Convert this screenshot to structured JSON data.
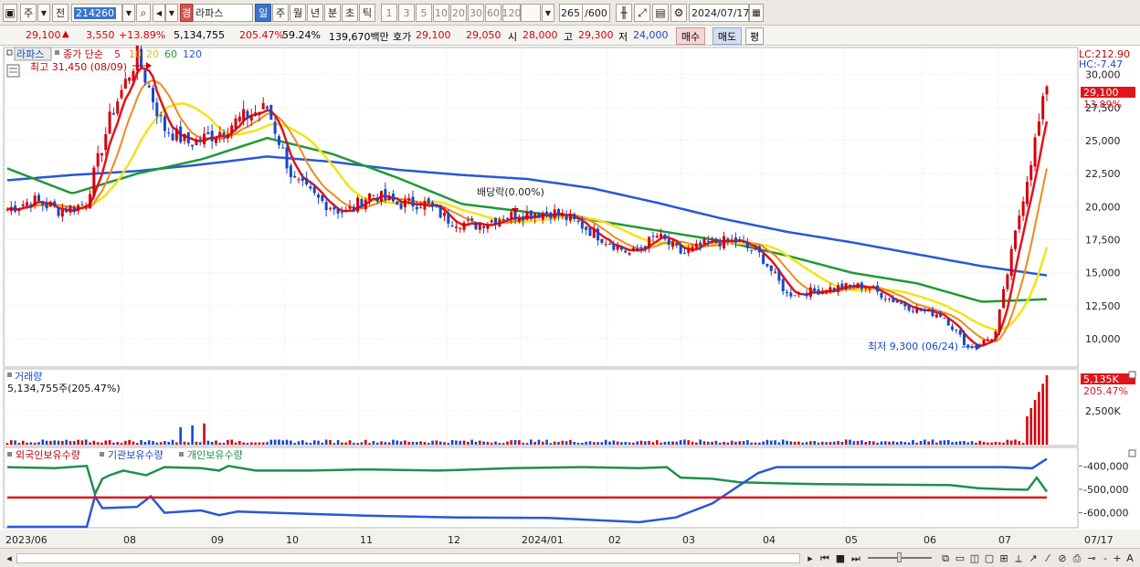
{
  "toolbar": {
    "market": "주",
    "prev": "전",
    "code": "214260",
    "name_prefix": "경",
    "name": "라파스",
    "periods": [
      "일",
      "주",
      "월",
      "년",
      "분",
      "초",
      "틱"
    ],
    "active_period": "일",
    "intervals": [
      "1",
      "3",
      "5",
      "10",
      "20",
      "30",
      "60",
      "120"
    ],
    "count": "265",
    "count_total": "/600",
    "date": "2024/07/17"
  },
  "quote": {
    "price": "29,100",
    "change": "3,550",
    "change_pct": "+13.89%",
    "volume": "5,134,755",
    "volume_ratio": "205.47%",
    "turnover_ratio": "59.24%",
    "amount": "139,670백만",
    "bid_label": "호가",
    "ask": "29,100",
    "bid": "29,050",
    "open_label": "시",
    "open": "28,000",
    "high_label": "고",
    "high": "29,300",
    "low_label": "저",
    "low": "24,000",
    "buy_label": "매수",
    "sell_label": "매도",
    "eval_label": "평"
  },
  "legend": {
    "name": "라파스",
    "ma_label": "종가 단순",
    "ma_periods": [
      "5",
      "10",
      "20",
      "60",
      "120"
    ],
    "max_label": "최고 31,450 (08/09)",
    "min_label": "최저 9,300 (06/24)",
    "dividend_label": "배당락(0.00%)",
    "lc": "LC:212.90",
    "hc": "HC:-7.47",
    "last_price": "29,100",
    "last_pct": "13.89%"
  },
  "volume_panel": {
    "title": "거래량",
    "value_label": "5,134,755주(205.47%)",
    "last_value": "5,135K",
    "last_pct": "205.47%"
  },
  "flow_panel": {
    "foreign": "외국인보유수량",
    "institution": "기관보유수량",
    "individual": "개인보유수량"
  },
  "colors": {
    "up": "#d4000d",
    "down": "#1747c9",
    "ma5": "#e0141a",
    "ma10": "#f08a1c",
    "ma20": "#f5e218",
    "ma60": "#1f9a34",
    "ma120": "#2857d9",
    "foreign": "#1f8f4d",
    "institution": "#2857d9",
    "individual": "#e0141a"
  },
  "chart_data": {
    "type": "line",
    "title": "라파스",
    "x_ticks": [
      "2023/06",
      "08",
      "09",
      "10",
      "11",
      "12",
      "2024/01",
      "02",
      "03",
      "04",
      "05",
      "06",
      "07",
      "07/17"
    ],
    "price_axis": {
      "ticks": [
        10000,
        12500,
        15000,
        17500,
        20000,
        22500,
        25000,
        27500,
        30000
      ],
      "tick_labels": [
        "10,000",
        "12,500",
        "15,000",
        "17,500",
        "20,000",
        "22,500",
        "25,000",
        "27,500",
        "30,000"
      ],
      "ylim": [
        8000,
        31500
      ]
    },
    "close_path": [
      [
        "2023/06",
        19800
      ],
      [
        "2023/07 early",
        20500
      ],
      [
        "2023/07 mid",
        19700
      ],
      [
        "2023/07 late",
        20200
      ],
      [
        "2023/08 early",
        27000
      ],
      [
        "2023/08/09",
        31450
      ],
      [
        "2023/08 mid",
        26000
      ],
      [
        "2023/08 late",
        24800
      ],
      [
        "2023/09 early",
        25500
      ],
      [
        "2023/09 mid",
        26700
      ],
      [
        "2023/09 late",
        27500
      ],
      [
        "2023/10 early",
        22000
      ],
      [
        "2023/10 mid",
        20500
      ],
      [
        "2023/10 late",
        19500
      ],
      [
        "2023/11 early",
        21000
      ],
      [
        "2023/11 mid",
        20200
      ],
      [
        "2023/11 late",
        20300
      ],
      [
        "2023/12 early",
        19000
      ],
      [
        "2023/12 mid",
        18600
      ],
      [
        "2023/12 late",
        19200
      ],
      [
        "2024/01 early",
        19500
      ],
      [
        "2024/01 mid",
        19600
      ],
      [
        "2024/01 late",
        18700
      ],
      [
        "2024/02 early",
        17500
      ],
      [
        "2024/02 mid",
        16400
      ],
      [
        "2024/02 late",
        17800
      ],
      [
        "2024/03 early",
        16400
      ],
      [
        "2024/03 mid",
        17300
      ],
      [
        "2024/03 late",
        17400
      ],
      [
        "2024/04 early",
        16300
      ],
      [
        "2024/04 mid",
        13400
      ],
      [
        "2024/04 late",
        13600
      ],
      [
        "2024/05 early",
        13900
      ],
      [
        "2024/05 mid",
        14000
      ],
      [
        "2024/05 late",
        13000
      ],
      [
        "2024/06 early",
        12200
      ],
      [
        "2024/06 mid",
        11800
      ],
      [
        "2024/06/24",
        9300
      ],
      [
        "2024/07 early",
        10200
      ],
      [
        "2024/07 mid",
        20000
      ],
      [
        "2024/07/17",
        29100
      ]
    ],
    "ma120_path": [
      22000,
      22400,
      22700,
      23200,
      23800,
      23400,
      22800,
      22400,
      22100,
      21400,
      20300,
      19100,
      18100,
      17300,
      16400,
      15500,
      14800
    ],
    "ma60_path": [
      22900,
      21000,
      22500,
      23600,
      25200,
      24000,
      22200,
      20200,
      19600,
      19000,
      18200,
      17400,
      16300,
      15000,
      14200,
      12800,
      13000
    ],
    "volume_axis": {
      "ticks": [
        2500000
      ],
      "tick_labels": [
        "2,500K"
      ]
    },
    "flow_axis": {
      "ticks": [
        -400000,
        -500000,
        -600000
      ],
      "tick_labels": [
        "-400,000",
        "-500,000",
        "-600,000"
      ]
    },
    "grid": true,
    "legend_position": "top-left"
  },
  "status": {
    "icons": [
      "scroll-right",
      "first-page",
      "stop",
      "last-page"
    ],
    "zoom": [
      "-",
      "+",
      "A"
    ]
  }
}
